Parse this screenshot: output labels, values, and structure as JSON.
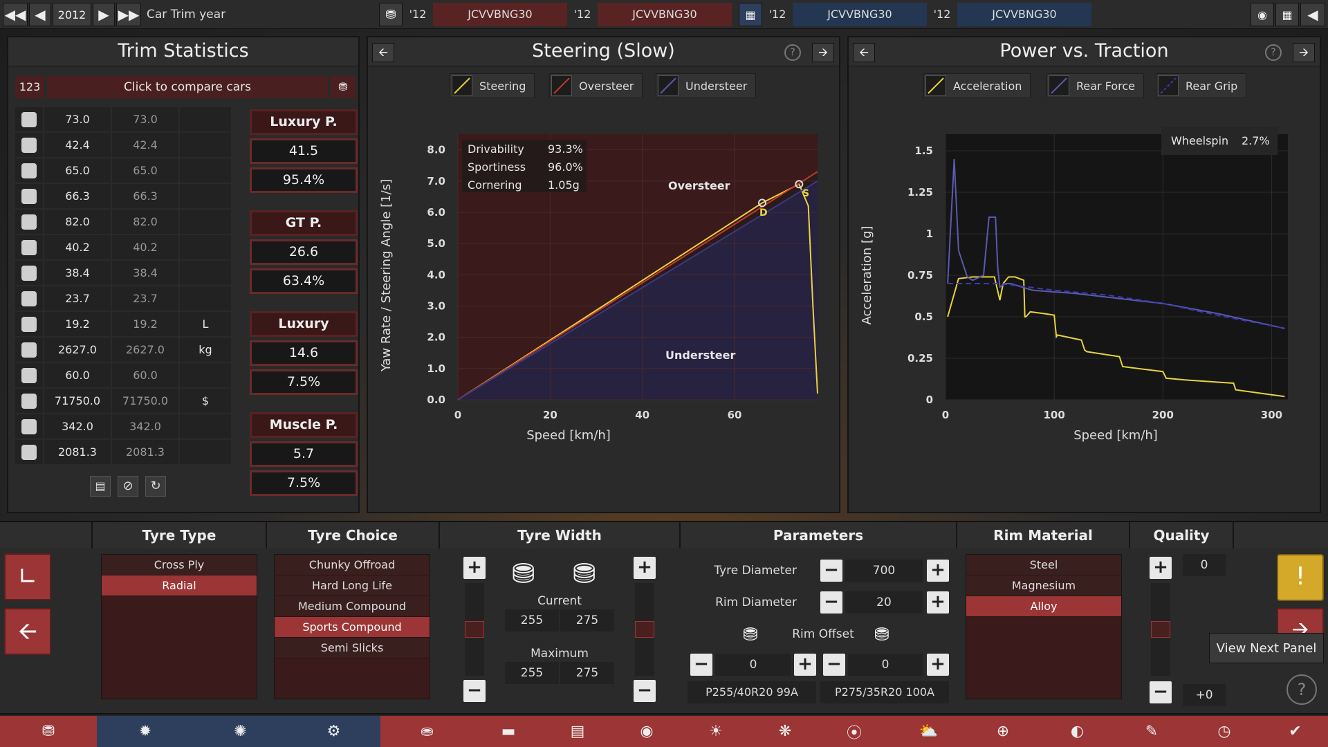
{
  "topbar": {
    "year": "2012",
    "trim_label": "Car Trim year",
    "cars": [
      {
        "year": "'12",
        "name": "JCVVBNG30"
      },
      {
        "year": "'12",
        "name": "JCVVBNG30"
      },
      {
        "year": "'12",
        "name": "JCVVBNG30"
      },
      {
        "year": "'12",
        "name": "JCVVBNG30"
      }
    ]
  },
  "trim_stats": {
    "title": "Trim Statistics",
    "compare_id": "123",
    "compare_label": "Click to compare cars",
    "rows": [
      {
        "icon": "steering-wheel-icon",
        "a": "73.0",
        "b": "73.0",
        "unit": ""
      },
      {
        "icon": "checkered-flag-icon",
        "a": "42.4",
        "b": "42.4",
        "unit": ""
      },
      {
        "icon": "seat-icon",
        "a": "65.0",
        "b": "65.0",
        "unit": ""
      },
      {
        "icon": "diamond-icon",
        "a": "66.3",
        "b": "66.3",
        "unit": ""
      },
      {
        "icon": "safety-icon",
        "a": "82.0",
        "b": "82.0",
        "unit": ""
      },
      {
        "icon": "passengers-icon",
        "a": "40.2",
        "b": "40.2",
        "unit": ""
      },
      {
        "icon": "cargo-icon",
        "a": "38.4",
        "b": "38.4",
        "unit": ""
      },
      {
        "icon": "offroad-icon",
        "a": "23.7",
        "b": "23.7",
        "unit": ""
      },
      {
        "icon": "fuel-icon",
        "a": "19.2",
        "b": "19.2",
        "unit": "L"
      },
      {
        "icon": "weight-icon",
        "a": "2627.0",
        "b": "2627.0",
        "unit": "kg"
      },
      {
        "icon": "service-icon",
        "a": "60.0",
        "b": "60.0",
        "unit": ""
      },
      {
        "icon": "money-bag-icon",
        "a": "71750.0",
        "b": "71750.0",
        "unit": "$"
      },
      {
        "icon": "production-icon",
        "a": "342.0",
        "b": "342.0",
        "unit": ""
      },
      {
        "icon": "engineering-icon",
        "a": "2081.3",
        "b": "2081.3",
        "unit": ""
      }
    ],
    "ratings": [
      {
        "name": "Luxury P.",
        "score": "41.5",
        "pct": "95.4%"
      },
      {
        "name": "GT P.",
        "score": "26.6",
        "pct": "63.4%"
      },
      {
        "name": "Luxury",
        "score": "14.6",
        "pct": "7.5%"
      },
      {
        "name": "Muscle P.",
        "score": "5.7",
        "pct": "7.5%"
      }
    ]
  },
  "steering": {
    "title": "Steering (Slow)",
    "legend": [
      "Steering",
      "Oversteer",
      "Understeer"
    ],
    "stats": [
      {
        "label": "Drivability",
        "value": "93.3%"
      },
      {
        "label": "Sportiness",
        "value": "96.0%"
      },
      {
        "label": "Cornering",
        "value": "1.05g"
      }
    ],
    "region_over": "Oversteer",
    "region_under": "Understeer",
    "marker_d": "D",
    "marker_s": "S"
  },
  "power": {
    "title": "Power vs. Traction",
    "legend": [
      "Acceleration",
      "Rear Force",
      "Rear Grip"
    ],
    "wheelspin_label": "Wheelspin",
    "wheelspin_value": "2.7%"
  },
  "chart_data": [
    {
      "type": "line",
      "title": "Steering (Slow)",
      "xlabel": "Speed [km/h]",
      "ylabel": "Yaw Rate / Steering Angle [1/s]",
      "xlim": [
        0,
        78
      ],
      "ylim": [
        0,
        8.5
      ],
      "xticks": [
        "0",
        "20",
        "40",
        "60"
      ],
      "yticks": [
        "0.0",
        "1.0",
        "2.0",
        "3.0",
        "4.0",
        "5.0",
        "6.0",
        "7.0",
        "8.0"
      ],
      "colors": {
        "Steering": "#e8d43a",
        "Oversteer": "#c0392b",
        "Understeer": "#3a3a80"
      },
      "series": [
        {
          "name": "Steering",
          "x": [
            0,
            66,
            74,
            76,
            77,
            78
          ],
          "y": [
            0,
            6.3,
            6.9,
            6.2,
            3.0,
            0.2
          ]
        },
        {
          "name": "Oversteer",
          "x": [
            0,
            78
          ],
          "y": [
            0,
            7.3
          ]
        },
        {
          "name": "Understeer",
          "x": [
            0,
            78
          ],
          "y": [
            0,
            7.0
          ]
        }
      ]
    },
    {
      "type": "line",
      "title": "Power vs. Traction",
      "xlabel": "Speed [km/h]",
      "ylabel": "Acceleration [g]",
      "xlim": [
        0,
        315
      ],
      "ylim": [
        0,
        1.6
      ],
      "xticks": [
        "0",
        "100",
        "200",
        "300"
      ],
      "yticks": [
        "0",
        "0.25",
        "0.5",
        "0.75",
        "1",
        "1.25",
        "1.5"
      ],
      "colors": {
        "Acceleration": "#e8d43a",
        "Rear Force": "#5a5ab0",
        "Rear Grip": "#3a3ab0"
      },
      "series": [
        {
          "name": "Acceleration",
          "x": [
            2,
            12,
            25,
            35,
            45,
            50,
            53,
            58,
            64,
            72,
            73,
            74,
            78,
            90,
            100,
            102,
            103,
            125,
            128,
            130,
            160,
            163,
            200,
            203,
            220,
            265,
            267,
            300,
            312
          ],
          "y": [
            0.5,
            0.73,
            0.74,
            0.74,
            0.74,
            0.6,
            0.7,
            0.74,
            0.74,
            0.72,
            0.5,
            0.5,
            0.53,
            0.52,
            0.51,
            0.38,
            0.39,
            0.36,
            0.3,
            0.29,
            0.26,
            0.2,
            0.17,
            0.13,
            0.12,
            0.1,
            0.06,
            0.03,
            0.02
          ]
        },
        {
          "name": "Rear Force",
          "x": [
            2,
            8,
            12,
            20,
            25,
            35,
            40,
            46,
            48,
            50,
            55,
            60,
            80,
            120,
            160,
            200,
            250,
            312
          ],
          "y": [
            0.7,
            1.45,
            0.9,
            0.74,
            0.72,
            0.75,
            1.1,
            1.1,
            0.8,
            0.68,
            0.7,
            0.7,
            0.66,
            0.64,
            0.61,
            0.58,
            0.52,
            0.43
          ]
        },
        {
          "name": "Rear Grip",
          "x": [
            2,
            50,
            100,
            150,
            200,
            250,
            312
          ],
          "y": [
            0.7,
            0.7,
            0.66,
            0.63,
            0.58,
            0.51,
            0.43
          ]
        }
      ]
    }
  ],
  "tyre_type": {
    "title": "Tyre Type",
    "items": [
      "Cross Ply",
      "Radial"
    ],
    "selected": 1
  },
  "tyre_choice": {
    "title": "Tyre Choice",
    "items": [
      "Chunky Offroad",
      "Hard Long Life",
      "Medium Compound",
      "Sports Compound",
      "Semi Slicks"
    ],
    "selected": 3
  },
  "tyre_width": {
    "title": "Tyre Width",
    "current_label": "Current",
    "maximum_label": "Maximum",
    "current_front": "255",
    "current_rear": "275",
    "max_front": "255",
    "max_rear": "275",
    "front_slider": 0.5,
    "rear_slider": 0.5
  },
  "parameters": {
    "title": "Parameters",
    "tyre_diameter_label": "Tyre Diameter",
    "tyre_diameter": "700",
    "rim_diameter_label": "Rim Diameter",
    "rim_diameter": "20",
    "rim_offset_label": "Rim Offset",
    "offset_front": "0",
    "offset_rear": "0",
    "spec_front": "P255/40R20 99A",
    "spec_rear": "P275/35R20 100A"
  },
  "rim_material": {
    "title": "Rim Material",
    "items": [
      "Steel",
      "Magnesium",
      "Alloy"
    ],
    "selected": 2
  },
  "quality": {
    "title": "Quality",
    "value": "0",
    "delta": "+0",
    "slider": 0.5
  },
  "side": {
    "tooltip": "View Next Panel"
  },
  "nav": [
    "car-body-icon",
    "engine-icon",
    "chassis-icon",
    "gearbox-icon",
    "trim-icon",
    "interior-icon",
    "fixture-icon",
    "aero-icon",
    "brakes-icon",
    "wheels-icon",
    "suspension-icon",
    "tuning-icon",
    "steering-icon",
    "safety-icon",
    "test-icon",
    "speedometer-icon",
    "done-icon"
  ]
}
